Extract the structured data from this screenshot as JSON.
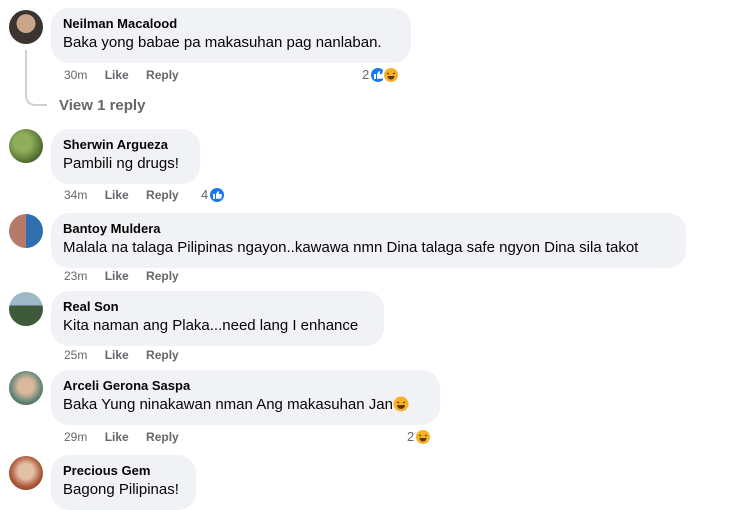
{
  "comments": [
    {
      "name": "Neilman Macalood",
      "text": "Baka yong babae pa makasuhan pag nanlaban.",
      "time": "30m",
      "like": "Like",
      "reply": "Reply",
      "reaction_count": "2",
      "reactions": [
        "like",
        "haha"
      ]
    },
    {
      "name": "Sherwin Argueza",
      "text": "Pambili ng drugs!",
      "time": "34m",
      "like": "Like",
      "reply": "Reply",
      "reaction_count": "4",
      "reactions": [
        "like"
      ]
    },
    {
      "name": "Bantoy Muldera",
      "text": "Malala na talaga Pilipinas ngayon..kawawa nmn Dina talaga safe ngyon Dina sila takot",
      "time": "23m",
      "like": "Like",
      "reply": "Reply"
    },
    {
      "name": "Real Son",
      "text": "Kita naman ang Plaka...need lang I enhance",
      "time": "25m",
      "like": "Like",
      "reply": "Reply"
    },
    {
      "name": "Arceli Gerona Saspa",
      "text": "Baka Yung ninakawan nman Ang makasuhan Jan",
      "time": "29m",
      "like": "Like",
      "reply": "Reply",
      "reaction_count": "2",
      "reactions": [
        "haha"
      ]
    },
    {
      "name": "Precious Gem",
      "text": "Bagong Pilipinas!"
    }
  ],
  "view_replies": "View 1 reply",
  "icons": {
    "like_reaction": "thumbs-up-icon",
    "haha_reaction": "laughing-emoji-icon"
  },
  "colors": {
    "bubble": "#f0f2f5",
    "like_blue": "#1877f2",
    "meta_gray": "#65676b"
  }
}
